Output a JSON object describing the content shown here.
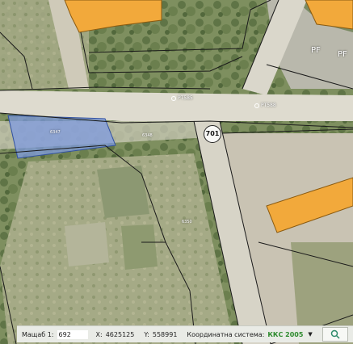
{
  "map": {
    "point_labels": [
      {
        "id": "pt585",
        "text": "PT585"
      },
      {
        "id": "pt588",
        "text": "PT588"
      }
    ],
    "parcel_labels": [
      "6347",
      "6348",
      "6350"
    ],
    "road_number": "701",
    "building_mark_left": "PF",
    "building_mark_right": "PF",
    "colors": {
      "road": "#d9d6c8",
      "parcel_fill": "#7f9be0",
      "building": "#f2a93b",
      "line": "#1a1a1a"
    }
  },
  "status_bar": {
    "scale_label": "Мащаб 1:",
    "scale_value": "692",
    "x_label": "X:",
    "x_value": "4625125",
    "y_label": "Y:",
    "y_value": "558991",
    "coord_label": "Координатна система:",
    "coord_value": "ККС 2005",
    "dropdown_icon": "chevron-down-icon",
    "search_icon": "search-icon"
  }
}
